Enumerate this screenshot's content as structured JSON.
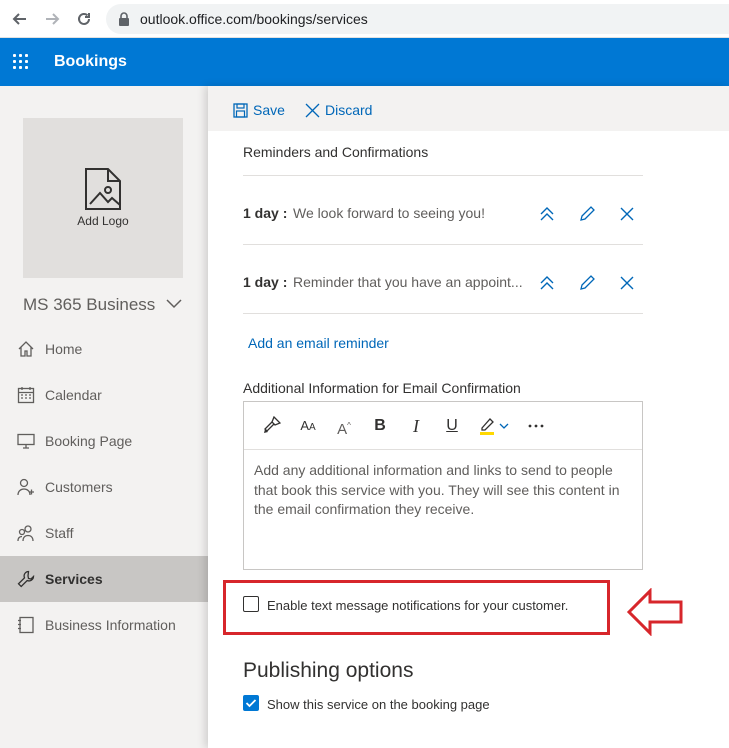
{
  "browser": {
    "url": "outlook.office.com/bookings/services"
  },
  "app": {
    "title": "Bookings"
  },
  "sidebar": {
    "logo_label": "Add Logo",
    "business_name": "MS 365 Business",
    "items": [
      {
        "label": "Home",
        "icon": "home-icon"
      },
      {
        "label": "Calendar",
        "icon": "calendar-icon"
      },
      {
        "label": "Booking Page",
        "icon": "monitor-icon"
      },
      {
        "label": "Customers",
        "icon": "customers-icon"
      },
      {
        "label": "Staff",
        "icon": "staff-icon"
      },
      {
        "label": "Services",
        "icon": "wrench-icon",
        "active": true
      },
      {
        "label": "Business Information",
        "icon": "info-icon"
      }
    ]
  },
  "commands": {
    "save": "Save",
    "discard": "Discard"
  },
  "reminders": {
    "section_title": "Reminders and Confirmations",
    "items": [
      {
        "day": "1 day :",
        "text": "We look forward to seeing you!"
      },
      {
        "day": "1 day :",
        "text": "Reminder that you have an appoint..."
      }
    ],
    "add_link": "Add an email reminder"
  },
  "email_confirmation": {
    "label": "Additional Information for Email Confirmation",
    "placeholder": "Add any additional information and links to send to people that book this service with you. They will see this content in the email confirmation they receive.",
    "toolbar": [
      "format-painter-icon",
      "font-size-icon",
      "superscript-icon",
      "bold-icon",
      "italic-icon",
      "underline-icon",
      "highlight-icon",
      "more-icon"
    ]
  },
  "sms": {
    "label": "Enable text message notifications for your customer.",
    "checked": false
  },
  "publishing": {
    "title": "Publishing options",
    "show_label": "Show this service on the booking page",
    "show_checked": true
  },
  "colors": {
    "brand": "#0078d4",
    "highlight_annotation": "#d7262b"
  }
}
